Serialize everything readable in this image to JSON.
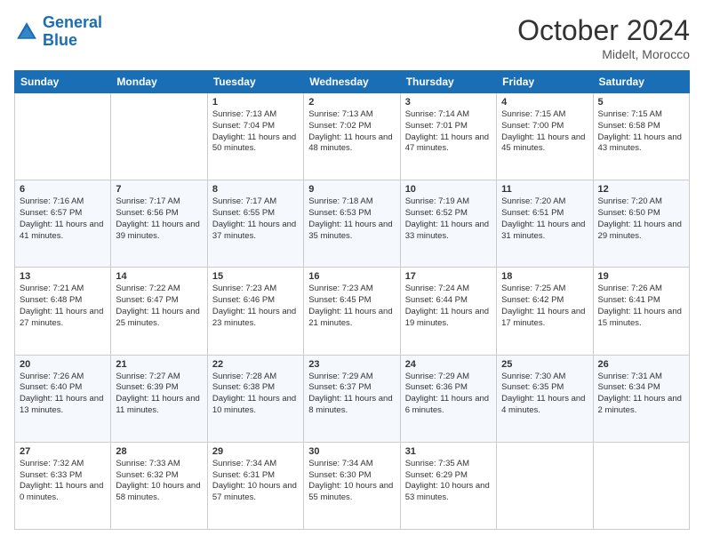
{
  "header": {
    "logo_line1": "General",
    "logo_line2": "Blue",
    "month_title": "October 2024",
    "location": "Midelt, Morocco"
  },
  "weekdays": [
    "Sunday",
    "Monday",
    "Tuesday",
    "Wednesday",
    "Thursday",
    "Friday",
    "Saturday"
  ],
  "weeks": [
    [
      {
        "day": "",
        "info": ""
      },
      {
        "day": "",
        "info": ""
      },
      {
        "day": "1",
        "info": "Sunrise: 7:13 AM\nSunset: 7:04 PM\nDaylight: 11 hours and 50 minutes."
      },
      {
        "day": "2",
        "info": "Sunrise: 7:13 AM\nSunset: 7:02 PM\nDaylight: 11 hours and 48 minutes."
      },
      {
        "day": "3",
        "info": "Sunrise: 7:14 AM\nSunset: 7:01 PM\nDaylight: 11 hours and 47 minutes."
      },
      {
        "day": "4",
        "info": "Sunrise: 7:15 AM\nSunset: 7:00 PM\nDaylight: 11 hours and 45 minutes."
      },
      {
        "day": "5",
        "info": "Sunrise: 7:15 AM\nSunset: 6:58 PM\nDaylight: 11 hours and 43 minutes."
      }
    ],
    [
      {
        "day": "6",
        "info": "Sunrise: 7:16 AM\nSunset: 6:57 PM\nDaylight: 11 hours and 41 minutes."
      },
      {
        "day": "7",
        "info": "Sunrise: 7:17 AM\nSunset: 6:56 PM\nDaylight: 11 hours and 39 minutes."
      },
      {
        "day": "8",
        "info": "Sunrise: 7:17 AM\nSunset: 6:55 PM\nDaylight: 11 hours and 37 minutes."
      },
      {
        "day": "9",
        "info": "Sunrise: 7:18 AM\nSunset: 6:53 PM\nDaylight: 11 hours and 35 minutes."
      },
      {
        "day": "10",
        "info": "Sunrise: 7:19 AM\nSunset: 6:52 PM\nDaylight: 11 hours and 33 minutes."
      },
      {
        "day": "11",
        "info": "Sunrise: 7:20 AM\nSunset: 6:51 PM\nDaylight: 11 hours and 31 minutes."
      },
      {
        "day": "12",
        "info": "Sunrise: 7:20 AM\nSunset: 6:50 PM\nDaylight: 11 hours and 29 minutes."
      }
    ],
    [
      {
        "day": "13",
        "info": "Sunrise: 7:21 AM\nSunset: 6:48 PM\nDaylight: 11 hours and 27 minutes."
      },
      {
        "day": "14",
        "info": "Sunrise: 7:22 AM\nSunset: 6:47 PM\nDaylight: 11 hours and 25 minutes."
      },
      {
        "day": "15",
        "info": "Sunrise: 7:23 AM\nSunset: 6:46 PM\nDaylight: 11 hours and 23 minutes."
      },
      {
        "day": "16",
        "info": "Sunrise: 7:23 AM\nSunset: 6:45 PM\nDaylight: 11 hours and 21 minutes."
      },
      {
        "day": "17",
        "info": "Sunrise: 7:24 AM\nSunset: 6:44 PM\nDaylight: 11 hours and 19 minutes."
      },
      {
        "day": "18",
        "info": "Sunrise: 7:25 AM\nSunset: 6:42 PM\nDaylight: 11 hours and 17 minutes."
      },
      {
        "day": "19",
        "info": "Sunrise: 7:26 AM\nSunset: 6:41 PM\nDaylight: 11 hours and 15 minutes."
      }
    ],
    [
      {
        "day": "20",
        "info": "Sunrise: 7:26 AM\nSunset: 6:40 PM\nDaylight: 11 hours and 13 minutes."
      },
      {
        "day": "21",
        "info": "Sunrise: 7:27 AM\nSunset: 6:39 PM\nDaylight: 11 hours and 11 minutes."
      },
      {
        "day": "22",
        "info": "Sunrise: 7:28 AM\nSunset: 6:38 PM\nDaylight: 11 hours and 10 minutes."
      },
      {
        "day": "23",
        "info": "Sunrise: 7:29 AM\nSunset: 6:37 PM\nDaylight: 11 hours and 8 minutes."
      },
      {
        "day": "24",
        "info": "Sunrise: 7:29 AM\nSunset: 6:36 PM\nDaylight: 11 hours and 6 minutes."
      },
      {
        "day": "25",
        "info": "Sunrise: 7:30 AM\nSunset: 6:35 PM\nDaylight: 11 hours and 4 minutes."
      },
      {
        "day": "26",
        "info": "Sunrise: 7:31 AM\nSunset: 6:34 PM\nDaylight: 11 hours and 2 minutes."
      }
    ],
    [
      {
        "day": "27",
        "info": "Sunrise: 7:32 AM\nSunset: 6:33 PM\nDaylight: 11 hours and 0 minutes."
      },
      {
        "day": "28",
        "info": "Sunrise: 7:33 AM\nSunset: 6:32 PM\nDaylight: 10 hours and 58 minutes."
      },
      {
        "day": "29",
        "info": "Sunrise: 7:34 AM\nSunset: 6:31 PM\nDaylight: 10 hours and 57 minutes."
      },
      {
        "day": "30",
        "info": "Sunrise: 7:34 AM\nSunset: 6:30 PM\nDaylight: 10 hours and 55 minutes."
      },
      {
        "day": "31",
        "info": "Sunrise: 7:35 AM\nSunset: 6:29 PM\nDaylight: 10 hours and 53 minutes."
      },
      {
        "day": "",
        "info": ""
      },
      {
        "day": "",
        "info": ""
      }
    ]
  ]
}
